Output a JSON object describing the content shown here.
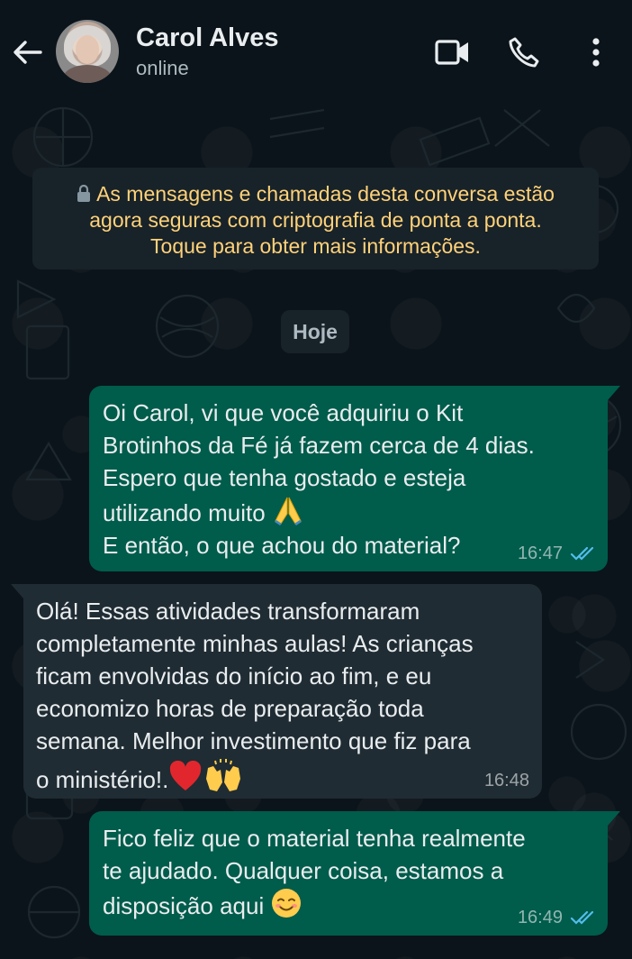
{
  "header": {
    "contact_name": "Carol Alves",
    "status": "online",
    "icons": [
      "back-arrow-icon",
      "video-call-icon",
      "phone-icon",
      "more-vert-icon"
    ]
  },
  "notice": {
    "lines": [
      "As mensagens e chamadas desta conversa estão",
      "agora seguras com criptografia de ponta a ponta.",
      "Toque para obter mais informações."
    ]
  },
  "date_separator": "Hoje",
  "messages": [
    {
      "direction": "outgoing",
      "lines": [
        "Oi Carol, vi que você adquiriu o Kit",
        "Brotinhos da Fé já fazem cerca de 4 dias.",
        "Espero que tenha gostado e esteja",
        "utilizando muito",
        "E então, o que achou do material?"
      ],
      "emojis": [
        "folded-hands"
      ],
      "time": "16:47",
      "status": "read"
    },
    {
      "direction": "incoming",
      "lines": [
        "Olá! Essas atividades transformaram",
        "completamente minhas aulas! As crianças",
        "ficam envolvidas do início ao fim, e eu",
        "economizo horas de preparação toda",
        "semana. Melhor investimento que fiz para",
        "o ministério!."
      ],
      "emojis": [
        "red-heart",
        "raising-hands"
      ],
      "time": "16:48"
    },
    {
      "direction": "outgoing",
      "lines": [
        "Fico feliz que o material tenha realmente",
        "te ajudado. Qualquer coisa, estamos a",
        "disposição aqui"
      ],
      "emojis": [
        "smiling-face"
      ],
      "time": "16:49",
      "status": "read"
    }
  ],
  "colors": {
    "background": "#0b141a",
    "outgoing_bubble": "#005c4b",
    "incoming_bubble": "#202c33",
    "notice_text": "#ffd279",
    "read_ticks": "#53bdeb"
  }
}
